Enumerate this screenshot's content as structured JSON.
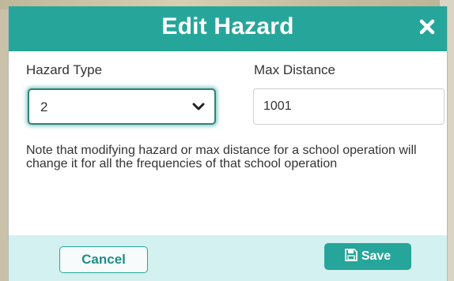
{
  "dialog": {
    "title": "Edit Hazard",
    "close_icon": "close-icon"
  },
  "form": {
    "hazard_type": {
      "label": "Hazard Type",
      "selected": "2"
    },
    "max_distance": {
      "label": "Max Distance",
      "value": "1001"
    },
    "note": "Note that modifying hazard or max distance for a school operation will change it for all the frequencies of that school operation"
  },
  "footer": {
    "cancel_label": "Cancel",
    "save_label": "Save",
    "save_icon": "floppy-disk-icon"
  },
  "colors": {
    "accent": "#26a69a",
    "footer_bg": "#d3f1f0"
  }
}
